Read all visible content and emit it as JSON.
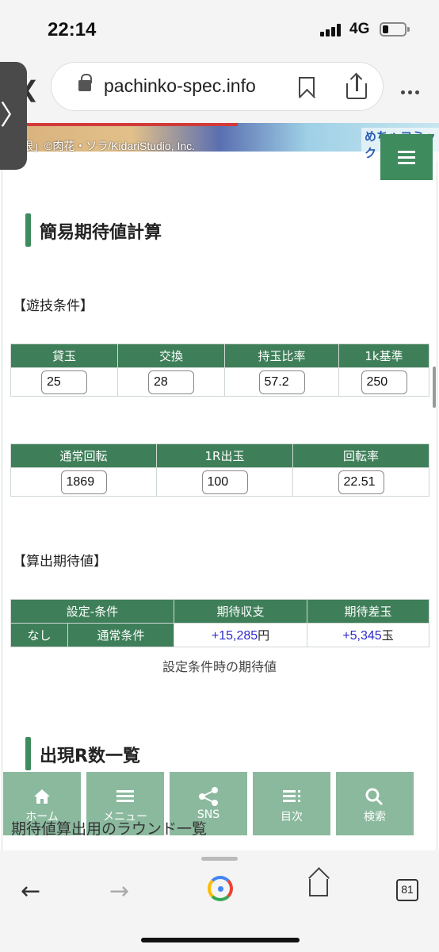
{
  "status_bar": {
    "time": "22:14",
    "network": "4G"
  },
  "browser": {
    "url": "pachinko-spec.info",
    "tab_count": "81"
  },
  "banner": {
    "credit": "眼」©肉花・ソラ/KidariStudio, Inc.",
    "logo": "めちゃコミック"
  },
  "section_calc": {
    "heading": "簡易期待値計算",
    "conditions_label": "【遊技条件】",
    "table1": {
      "headers": [
        "貸玉",
        "交換",
        "持玉比率",
        "1k基準"
      ],
      "values": [
        "25",
        "28",
        "57.2",
        "250"
      ]
    },
    "table2": {
      "headers": [
        "通常回転",
        "1R出玉",
        "回転率"
      ],
      "values": [
        "1869",
        "100",
        "22.51"
      ]
    },
    "result_label": "【算出期待値】",
    "result_table": {
      "headers": [
        "設定-条件",
        "期待収支",
        "期待差玉"
      ],
      "setting": "なし",
      "condition": "通常条件",
      "income_value": "+15,285",
      "income_unit": "円",
      "diff_value": "+5,345",
      "diff_unit": "玉"
    },
    "caption": "設定条件時の期待値"
  },
  "section_rounds": {
    "heading": "出現R数一覧",
    "overlay_text": "期待値算出用のラウンド一覧"
  },
  "bottom_nav": [
    {
      "label": "ホーム",
      "icon": "home-icon"
    },
    {
      "label": "メニュー",
      "icon": "menu-icon"
    },
    {
      "label": "SNS",
      "icon": "share-nodes-icon"
    },
    {
      "label": "目次",
      "icon": "list-icon"
    },
    {
      "label": "検索",
      "icon": "search-icon"
    }
  ],
  "colors": {
    "accent_green": "#3e8b5e",
    "value_blue": "#2c2cc8"
  }
}
